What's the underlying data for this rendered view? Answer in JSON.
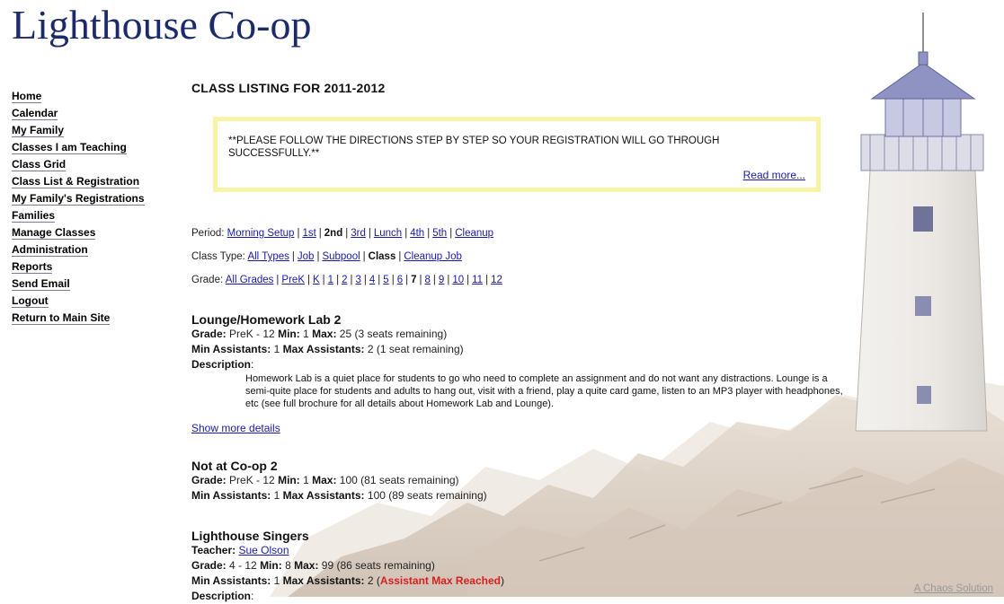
{
  "site": {
    "title": "Lighthouse Co-op"
  },
  "nav": {
    "items": [
      {
        "label": "Home"
      },
      {
        "label": "Calendar"
      },
      {
        "label": "My Family"
      },
      {
        "label": "Classes I am Teaching"
      },
      {
        "label": "Class Grid"
      },
      {
        "label": "Class List & Registration"
      },
      {
        "label": "My Family's Registrations"
      },
      {
        "label": "Families"
      },
      {
        "label": "Manage Classes"
      },
      {
        "label": "Administration"
      },
      {
        "label": "Reports"
      },
      {
        "label": "Send Email"
      },
      {
        "label": "Logout"
      },
      {
        "label": "Return to Main Site"
      }
    ]
  },
  "main": {
    "heading": "CLASS LISTING FOR 2011-2012",
    "notice": {
      "text": "**PLEASE FOLLOW THE DIRECTIONS STEP BY STEP SO YOUR REGISTRATION WILL GO THROUGH SUCCESSFULLY.**",
      "read_more": "Read more..."
    },
    "filters": {
      "period": {
        "label": "Period:",
        "options": [
          "Morning Setup",
          "1st",
          "2nd",
          "3rd",
          "Lunch",
          "4th",
          "5th",
          "Cleanup"
        ],
        "selected": "2nd"
      },
      "class_type": {
        "label": "Class Type:",
        "options": [
          "All Types",
          "Job",
          "Subpool",
          "Class",
          "Cleanup Job"
        ],
        "selected": "Class"
      },
      "grade": {
        "label": "Grade:",
        "options": [
          "All Grades",
          "PreK",
          "K",
          "1",
          "2",
          "3",
          "4",
          "5",
          "6",
          "7",
          "8",
          "9",
          "10",
          "11",
          "12"
        ],
        "selected": "7"
      }
    },
    "labels": {
      "grade": "Grade:",
      "min": "Min:",
      "max": "Max:",
      "min_assistants": "Min Assistants:",
      "max_assistants": "Max Assistants:",
      "description": "Description",
      "teacher": "Teacher:"
    },
    "classes": [
      {
        "title": "Lounge/Homework Lab 2",
        "grade": "PreK - 12",
        "min": "1",
        "max": "25 (3 seats remaining)",
        "min_assistants": "1",
        "max_assistants": "2 (1 seat remaining)",
        "description": "Homework Lab is a quiet place for students to go who need to complete an assignment and do not want any distractions. Lounge is a semi-quite place for students and adults to hang out, visit with a friend, play a quite card game, listen to an MP3 player with headphones, etc (see full brochure for all details about Homework Lab and Lounge).",
        "show_more": "Show more details"
      },
      {
        "title": "Not at Co-op 2",
        "grade": "PreK - 12",
        "min": "1",
        "max": "100 (81 seats remaining)",
        "min_assistants": "1",
        "max_assistants": "100 (89 seats remaining)"
      },
      {
        "title": "Lighthouse Singers",
        "teacher": "Sue Olson",
        "grade": "4 - 12",
        "min": "8",
        "max": "99 (86 seats remaining)",
        "min_assistants": "1",
        "max_assistants_prefix": "2 (",
        "max_assistants_status": "Assistant Max Reached",
        "max_assistants_suffix": ")",
        "description_label": "Description"
      }
    ]
  },
  "footer": {
    "credit": "A Chaos Solution"
  }
}
